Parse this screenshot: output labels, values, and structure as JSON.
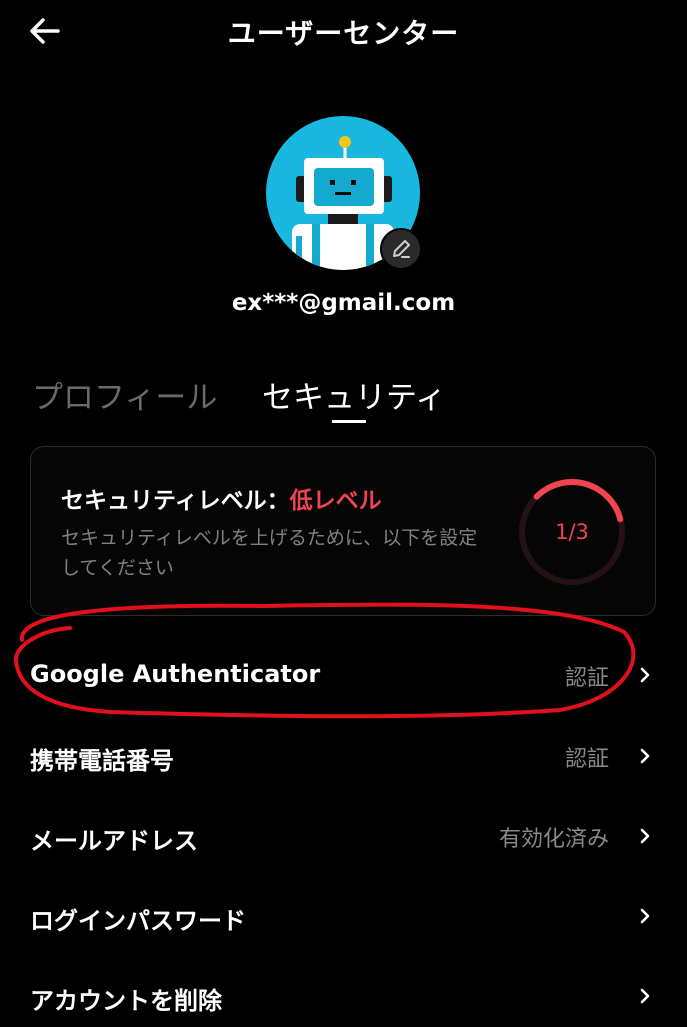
{
  "header": {
    "title": "ユーザーセンター",
    "back_icon": "arrow-left-icon"
  },
  "profile": {
    "email": "ex***@gmail.com",
    "avatar_icon": "robot-avatar",
    "edit_icon": "pencil-icon"
  },
  "tabs": [
    {
      "label": "プロフィール",
      "active": false
    },
    {
      "label": "セキュリティ",
      "active": true
    }
  ],
  "security_card": {
    "title_prefix": "セキュリティレベル：",
    "level": "低レベル",
    "description": "セキュリティレベルを上げるために、以下を設定してください",
    "progress": "1/3",
    "progress_value": 1,
    "progress_total": 3,
    "accent_color": "#f0454f"
  },
  "rows": [
    {
      "label": "Google Authenticator",
      "status": "認証"
    },
    {
      "label": "携帯電話番号",
      "status": "認証"
    },
    {
      "label": "メールアドレス",
      "status": "有効化済み"
    },
    {
      "label": "ログインパスワード",
      "status": ""
    },
    {
      "label": "アカウントを削除",
      "status": ""
    }
  ],
  "annotation": {
    "shape": "hand-drawn ellipse",
    "color": "#e0101c",
    "target": "Google Authenticator"
  }
}
